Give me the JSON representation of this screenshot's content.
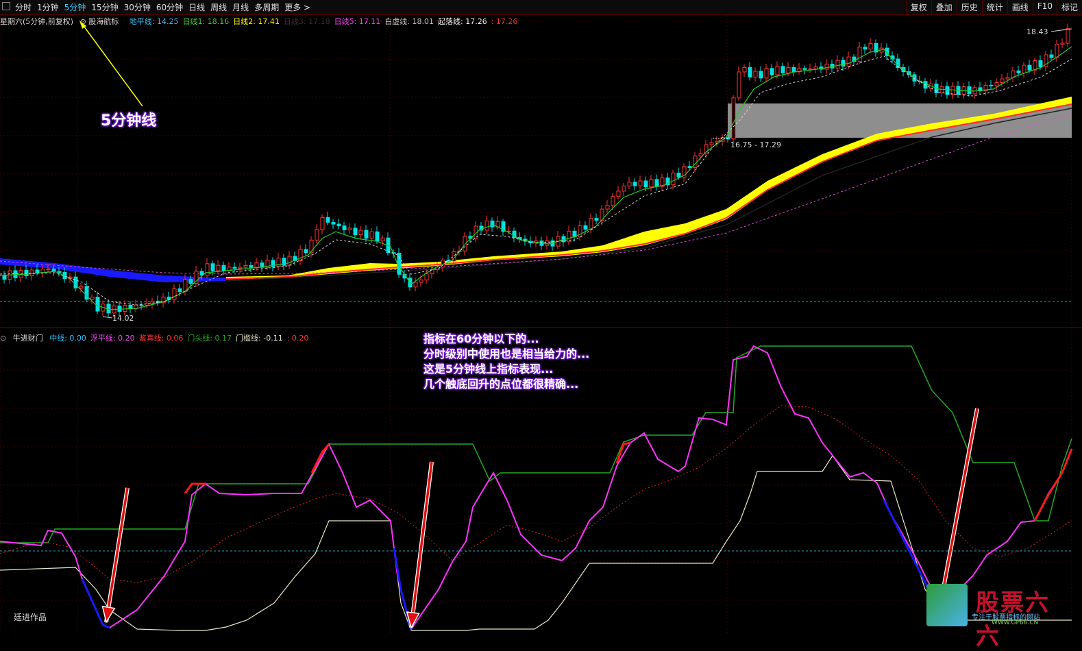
{
  "toolbar": {
    "periods": [
      "分时",
      "1分钟",
      "5分钟",
      "15分钟",
      "30分钟",
      "60分钟",
      "日线",
      "周线",
      "月线",
      "多周期",
      "更多 >"
    ],
    "active_period": "5分钟",
    "tools": [
      "复权",
      "叠加",
      "历史",
      "统计",
      "画线",
      "F10",
      "标记"
    ]
  },
  "main_legend": {
    "title": "星期六(5分钟,前复权)",
    "indicator": "股海航标",
    "items": [
      {
        "label": "地平线:",
        "value": "14.25",
        "color": "#33c7ff"
      },
      {
        "label": "日线1:",
        "value": "18.16",
        "color": "#3ddc3d"
      },
      {
        "label": "日线2:",
        "value": "17.41",
        "color": "#ffff00"
      },
      {
        "label": "日线3:",
        "value": "17.18",
        "color": "#333333"
      },
      {
        "label": "日线5:",
        "value": "17.11",
        "color": "#ff44ff"
      },
      {
        "label": "白虚线:",
        "value": "18.01",
        "color": "#cccccc"
      },
      {
        "label": "起落线:",
        "value": "17.26",
        "color": "#ffffff"
      },
      {
        "label": ":",
        "value": "17.26",
        "color": "#ff3333"
      }
    ]
  },
  "price_labels": {
    "high": "18.43",
    "low": "14.02",
    "zone": "16.75 - 17.29"
  },
  "sub_legend": {
    "indicator": "牛进财门",
    "items": [
      {
        "label": "中线:",
        "value": "0.00",
        "color": "#33c7ff"
      },
      {
        "label": "浮平线:",
        "value": "0.20",
        "color": "#ff44ff"
      },
      {
        "label": "鉴真线:",
        "value": "0.06",
        "color": "#ff3333"
      },
      {
        "label": "门头线:",
        "value": "0.17",
        "color": "#22aa22"
      },
      {
        "label": "门槛线:",
        "value": "-0.11",
        "color": "#e0e0c0"
      },
      {
        "label": ":",
        "value": "0.20",
        "color": "#ff3333"
      }
    ]
  },
  "callouts": {
    "five_min": "5分钟线",
    "notes": [
      "指标在60分钟以下的...",
      "分时级别中使用也是相当给力的...",
      "这是5分钟线上指标表现...",
      "几个触底回升的点位都很精确..."
    ]
  },
  "author": "廷进作品",
  "watermark": {
    "name": "股票六六",
    "slogan": "专注于股票指标的网站",
    "url": "WWW.GP66.CN"
  },
  "colors": {
    "bull": "#ff3333",
    "bear": "#00e0e0",
    "ma_green": "#22cc22",
    "band_yellow": "#ffff00",
    "band_blue": "#1a1aff"
  }
}
